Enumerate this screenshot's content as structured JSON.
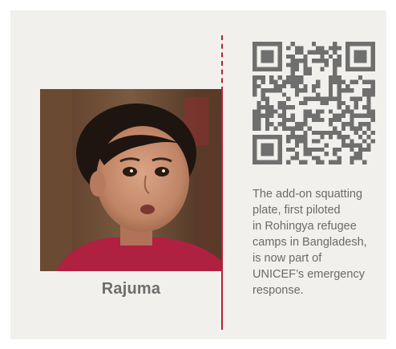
{
  "photo": {
    "caption": "Rajuma"
  },
  "qr_code": {
    "icon": "qr-code-icon"
  },
  "description": {
    "text": "The add-on squatting\nplate, first piloted\nin Rohingya refugee\ncamps in Bangladesh,\nis now part of\nUNICEF’s emergency\nresponse."
  },
  "colors": {
    "background": "#f1f0ec",
    "divider": "#b4233a",
    "text": "#6a6a6a",
    "qr": "#6f6f6f"
  }
}
